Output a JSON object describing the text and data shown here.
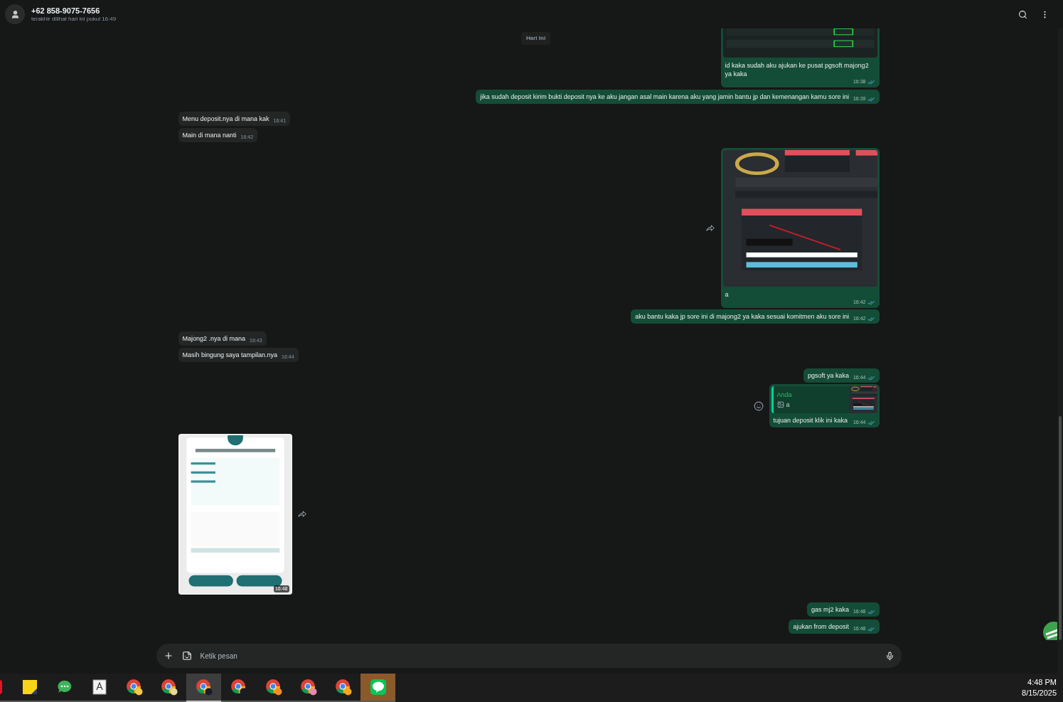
{
  "header": {
    "name": "+62 858-9075-7656",
    "status": "terakhir dilihat hari ini pukul 16:49"
  },
  "date_chip": "Hari Ini",
  "messages": [
    {
      "outgoing": true,
      "caption": "id kaka sudah aku ajukan ke pusat pgsoft majong2 ya kaka",
      "time": "16:38",
      "read": true
    },
    {
      "kind": "text",
      "outgoing": true,
      "text": "jika sudah deposit kirim bukti deposit nya ke aku jangan asal main karena aku yang jamin bantu jp dan kemenangan kamu sore ini",
      "time": "16:39",
      "read": true
    },
    {
      "kind": "text",
      "outgoing": false,
      "text": "Menu deposit.nya di mana kak",
      "time": "16:41"
    },
    {
      "kind": "text",
      "outgoing": false,
      "text": "Main di mana nanti",
      "time": "16:42"
    },
    {
      "outgoing": true,
      "caption": "a",
      "time": "16:42",
      "read": true,
      "forward": true
    },
    {
      "kind": "text",
      "outgoing": true,
      "text": "aku bantu kaka jp sore ini di majong2 ya kaka sesuai komitmen aku sore ini",
      "time": "16:42",
      "read": true
    },
    {
      "kind": "text",
      "outgoing": false,
      "text": "Majong2 .nya di mana",
      "time": "16:43"
    },
    {
      "kind": "text",
      "outgoing": false,
      "text": "Masih bingung saya tampilan.nya",
      "time": "16:44"
    },
    {
      "kind": "text",
      "outgoing": true,
      "text": "pgsoft ya kaka",
      "time": "16:44",
      "read": true
    },
    {
      "kind": "reply",
      "outgoing": true,
      "quote": {
        "author": "Anda",
        "text": "a"
      },
      "text": "tujuan deposit klik ini kaka",
      "time": "16:44",
      "read": true,
      "react": true
    },
    {
      "outgoing": false,
      "time": "16:48",
      "forward": true
    },
    {
      "kind": "text",
      "outgoing": true,
      "text": "gas mj2 kaka",
      "time": "16:48",
      "read": true
    },
    {
      "kind": "text",
      "outgoing": true,
      "text": "ajukan from deposit",
      "time": "16:48",
      "read": true
    }
  ],
  "composer": {
    "placeholder": "Ketik pesan"
  },
  "taskbar": {
    "apps": [
      {
        "kind": "red-app",
        "selected": false,
        "flashing": false
      },
      {
        "kind": "sticky-notes",
        "selected": false,
        "flashing": false
      },
      {
        "kind": "chat",
        "selected": false,
        "flashing": false
      },
      {
        "kind": "document",
        "selected": false,
        "flashing": false
      },
      {
        "kind": "browser",
        "color": "#f2c94c",
        "selected": false,
        "flashing": false
      },
      {
        "kind": "browser",
        "color": "#e8d9a0",
        "selected": false,
        "flashing": false
      },
      {
        "kind": "browser",
        "color": "#1a1a2e",
        "selected": true,
        "flashing": false
      },
      {
        "kind": "browser",
        "color": "#1a1a2e",
        "selected": false,
        "flashing": false
      },
      {
        "kind": "browser",
        "color": "#f28c28",
        "selected": false,
        "flashing": false
      },
      {
        "kind": "browser",
        "color": "#e88ab0",
        "selected": false,
        "flashing": false
      },
      {
        "kind": "browser",
        "color": "#f5a623",
        "selected": false,
        "flashing": false
      },
      {
        "kind": "line",
        "selected": false,
        "flashing": true
      }
    ],
    "time": "4:48 PM",
    "date": "8/15/2025"
  }
}
